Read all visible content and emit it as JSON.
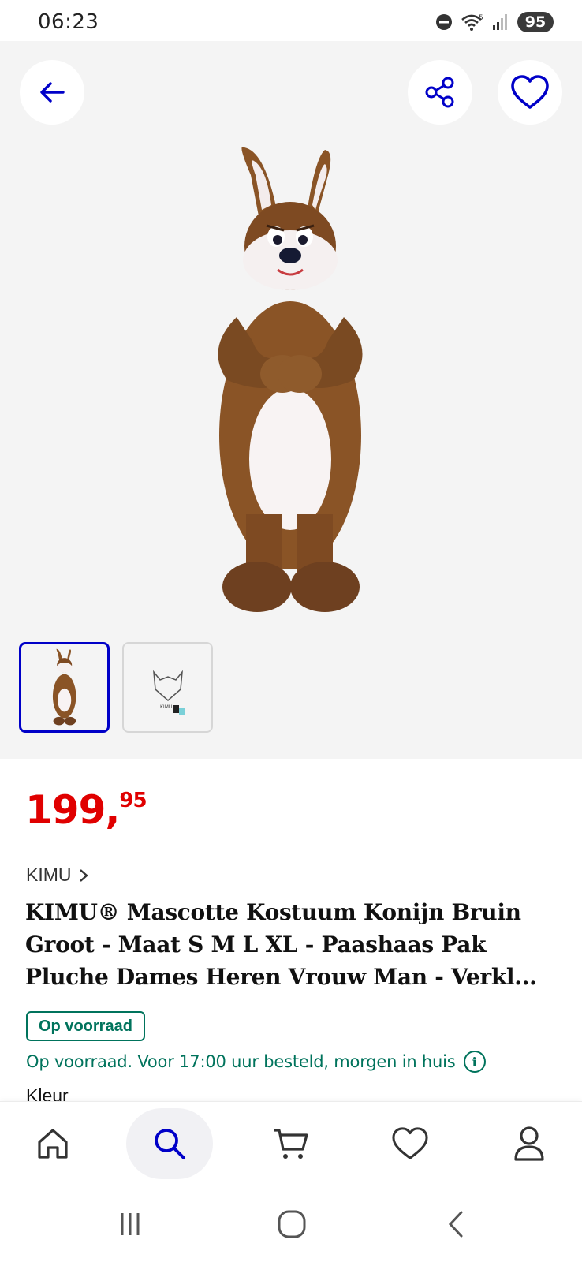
{
  "status_bar": {
    "time": "06:23",
    "battery": "95",
    "icons": [
      "do-not-disturb-icon",
      "wifi-icon",
      "signal-icon",
      "battery-icon"
    ]
  },
  "gallery": {
    "back_icon": "arrow-left-icon",
    "share_icon": "share-icon",
    "favorite_icon": "heart-icon",
    "thumbnail_count": 2,
    "active_thumbnail": 1
  },
  "product": {
    "price_main": "199,",
    "price_cents": "95",
    "brand": "KIMU",
    "title_lines": [
      "KIMU® Mascotte Kostuum Konijn Bruin",
      "Groot - Maat S M L XL - Paashaas Pak",
      "Pluche Dames Heren Vrouw Man - Verkl..."
    ],
    "stock_badge": "Op voorraad",
    "delivery_text": "Op voorraad. Voor 17:00 uur besteld, morgen in huis",
    "info_icon_label": "i",
    "next_section": "Kleur"
  },
  "bottom_nav": {
    "items": [
      "home",
      "search",
      "cart",
      "favorites",
      "account"
    ],
    "active": "search"
  },
  "colors": {
    "accent": "#0000c8",
    "price": "#e00000",
    "stock": "#00735c",
    "gallery_bg": "#f4f4f4"
  }
}
